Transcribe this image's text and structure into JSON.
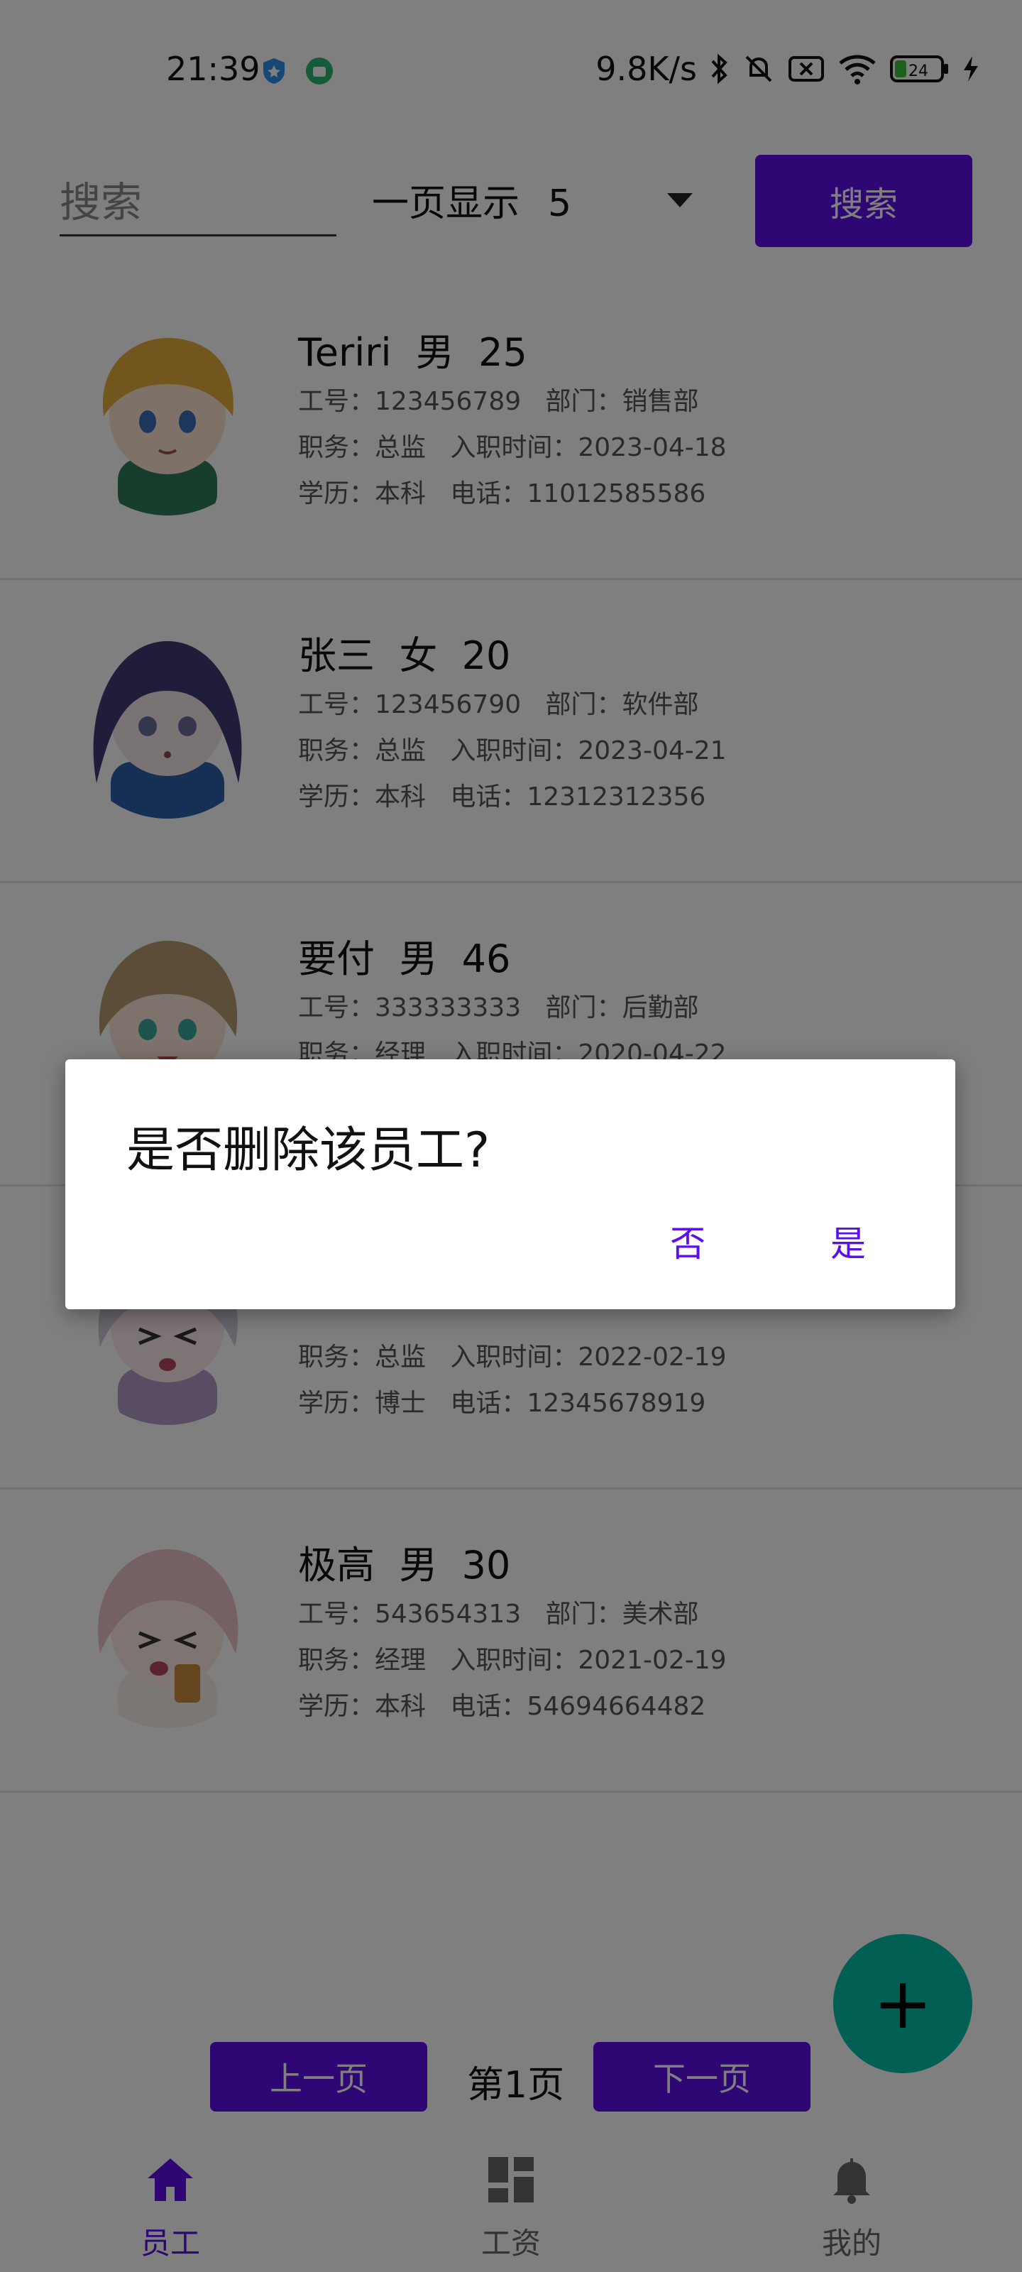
{
  "status_bar": {
    "time": "21:39",
    "net_speed": "9.8K/s",
    "battery": "24"
  },
  "search": {
    "placeholder": "搜索",
    "page_size_label": "一页显示",
    "page_size_value": "5",
    "button_label": "搜索"
  },
  "employees": [
    {
      "name_line": "Teriri  男  25",
      "line1": "工号：123456789   部门：销售部",
      "line2": "职务：总监   入职时间：2023-04-18",
      "line3": "学历：本科   电话：11012585586",
      "hair_color": "#e2ad3a",
      "shirt_color": "#2f7b5a"
    },
    {
      "name_line": "张三  女  20",
      "line1": "工号：123456790   部门：软件部",
      "line2": "职务：总监   入职时间：2023-04-21",
      "line3": "学历：本科   电话：12312312356",
      "hair_color": "#3f3a72",
      "shirt_color": "#2d5fa8"
    },
    {
      "name_line": "要付  男  46",
      "line1": "工号：333333333   部门：后勤部",
      "line2": "职务：经理   入职时间：2020-04-22",
      "line3": "",
      "hair_color": "#b89b72",
      "shirt_color": "#9a5d4e"
    },
    {
      "name_line": "",
      "line1": "",
      "line2": "职务：总监   入职时间：2022-02-19",
      "line3": "学历：博士   电话：12345678919",
      "hair_color": "#cfc8d9",
      "shirt_color": "#b29ac9"
    },
    {
      "name_line": "极高  男  30",
      "line1": "工号：543654313   部门：美术部",
      "line2": "职务：经理   入职时间：2021-02-19",
      "line3": "学历：本科   电话：54694664482",
      "hair_color": "#eac0c8",
      "shirt_color": "#f4efe9"
    }
  ],
  "dialog": {
    "title": "是否删除该员工?",
    "no_label": "否",
    "yes_label": "是"
  },
  "fab": {
    "label": "+"
  },
  "pager": {
    "prev_label": "上一页",
    "page_label": "第1页",
    "next_label": "下一页"
  },
  "bottom_nav": [
    {
      "label": "员工",
      "icon": "home-icon",
      "active": true
    },
    {
      "label": "工资",
      "icon": "dashboard-icon",
      "active": false
    },
    {
      "label": "我的",
      "icon": "bell-icon",
      "active": false
    }
  ],
  "colors": {
    "accent": "#5c0fe8",
    "fab": "#03bfa6"
  }
}
